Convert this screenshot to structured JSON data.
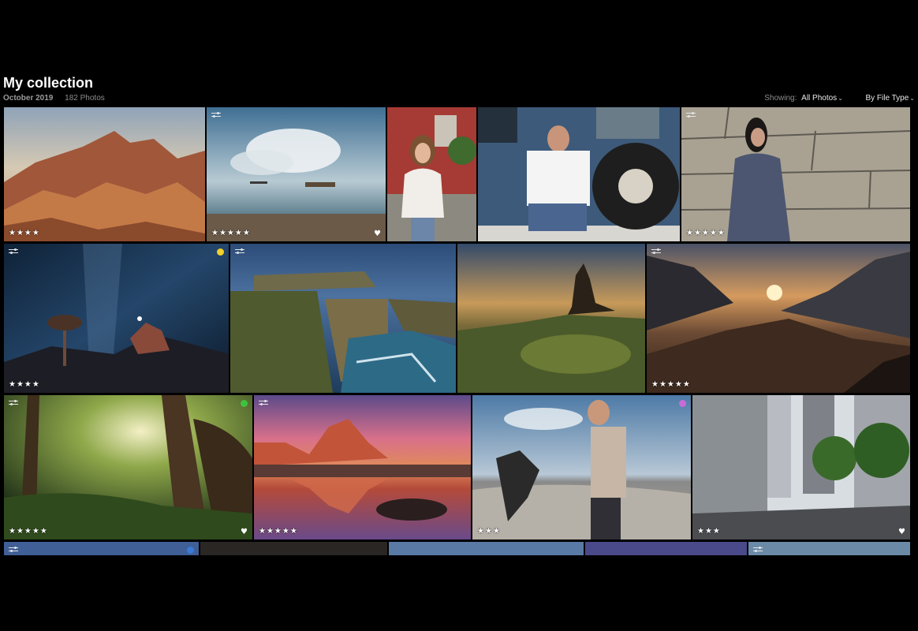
{
  "header": {
    "title": "My collection",
    "date": "October 2019",
    "count": "182 Photos",
    "showing_label": "Showing:",
    "showing_value": "All Photos",
    "sort_value": "By File Type"
  },
  "photos": [
    {
      "id": "desert-rocks",
      "rating": "★★★★",
      "heart": "",
      "dot": ""
    },
    {
      "id": "seascape-boats",
      "rating": "★★★★★",
      "heart": "♥",
      "dot": ""
    },
    {
      "id": "woman-barn",
      "rating": "",
      "heart": "",
      "dot": ""
    },
    {
      "id": "man-van",
      "rating": "",
      "heart": "",
      "dot": ""
    },
    {
      "id": "woman-stone-wall",
      "rating": "★★★★★",
      "heart": "",
      "dot": ""
    },
    {
      "id": "milky-way-tree",
      "rating": "★★★★",
      "heart": "",
      "dot": "#f2d22a"
    },
    {
      "id": "sea-cliffs",
      "rating": "",
      "heart": "",
      "dot": ""
    },
    {
      "id": "rock-spire",
      "rating": "",
      "heart": "",
      "dot": ""
    },
    {
      "id": "mountain-sunset",
      "rating": "★★★★★",
      "heart": "",
      "dot": ""
    },
    {
      "id": "forest-light",
      "rating": "★★★★★",
      "heart": "♥",
      "dot": "#3ec23e"
    },
    {
      "id": "mountain-reflection",
      "rating": "★★★★★",
      "heart": "",
      "dot": ""
    },
    {
      "id": "skateboarders",
      "rating": "★★★",
      "heart": "",
      "dot": "#c86bd9"
    },
    {
      "id": "city-street",
      "rating": "★★★",
      "heart": "♥",
      "dot": ""
    }
  ],
  "colors": {
    "selected_border": "#c9a05a",
    "background": "#000000"
  }
}
